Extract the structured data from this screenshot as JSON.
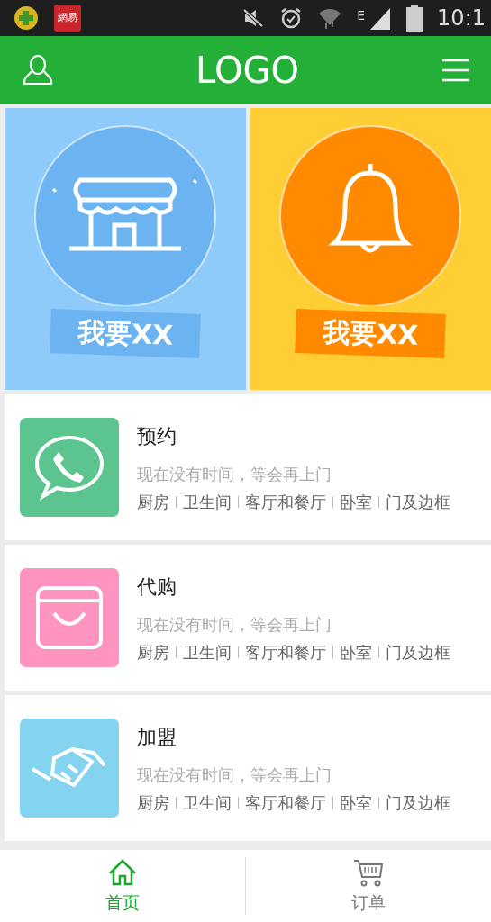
{
  "status_bar": {
    "app_badge": "網易",
    "network": "E",
    "time": "10:1"
  },
  "header": {
    "logo": "LOGO"
  },
  "banners": [
    {
      "kind": "shop",
      "label": "我要XX",
      "color": "#8ecafa"
    },
    {
      "kind": "bell",
      "label": "我要XX",
      "color": "#ffcd34"
    }
  ],
  "services": [
    {
      "kind": "phone",
      "color": "#5cc48e",
      "title": "预约",
      "subtitle": "现在没有时间，等会再上门",
      "tags": [
        "厨房",
        "卫生间",
        "客厅和餐厅",
        "卧室",
        "门及边框"
      ]
    },
    {
      "kind": "bag",
      "color": "#ff94c0",
      "title": "代购",
      "subtitle": "现在没有时间，等会再上门",
      "tags": [
        "厨房",
        "卫生间",
        "客厅和餐厅",
        "卧室",
        "门及边框"
      ]
    },
    {
      "kind": "handshake",
      "color": "#84d4f0",
      "title": "加盟",
      "subtitle": "现在没有时间，等会再上门",
      "tags": [
        "厨房",
        "卫生间",
        "客厅和餐厅",
        "卧室",
        "门及边框"
      ]
    }
  ],
  "tabs": [
    {
      "kind": "home",
      "label": "首页",
      "selected": true
    },
    {
      "kind": "cart",
      "label": "订单",
      "selected": false
    }
  ]
}
